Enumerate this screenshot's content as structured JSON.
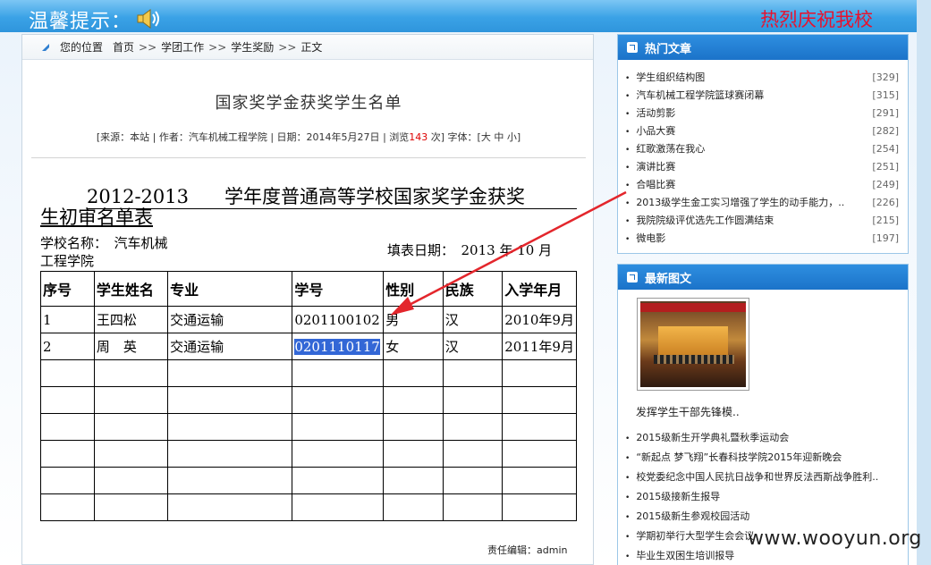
{
  "notice": {
    "label": "温馨提示：",
    "marquee": "热烈庆祝我校"
  },
  "breadcrumb": {
    "prefix": "您的位置",
    "items": [
      "首页",
      "学团工作",
      "学生奖励",
      "正文"
    ],
    "separator": ">>"
  },
  "article": {
    "title": "国家奖学金获奖学生名单",
    "meta": {
      "source": "[来源：本站",
      "author": "| 作者：汽车机械工程学院",
      "date": "| 日期：2014年5月27日",
      "views_prefix": "| 浏览",
      "views": "143",
      "views_suffix": "次] 字体：[大 中 小]"
    },
    "doc_title_year": "2012-2013",
    "doc_title_rest": "学年度普通高等学校国家奖学金获奖",
    "doc_title_line2": "生初审名单表",
    "school_label": "学校名称：　汽车机械工程学院",
    "fill_date": "填表日期：　2013 年 10 月",
    "table_headers": [
      "序号",
      "学生姓名",
      "专业",
      "学号",
      "性别",
      "民族",
      "入学年月"
    ],
    "rows": [
      [
        "1",
        "王四松",
        "交通运输",
        "0201100102",
        "男",
        "汉",
        "2010年9月"
      ],
      [
        "2",
        "周　英",
        "交通运输",
        "0201110117",
        "女",
        "汉",
        "2011年9月"
      ]
    ],
    "editor": "责任编辑：admin"
  },
  "hot_articles": {
    "title": "热门文章",
    "items": [
      {
        "text": "学生组织结构图",
        "count": "[329]"
      },
      {
        "text": "汽车机械工程学院篮球赛闭幕",
        "count": "[315]"
      },
      {
        "text": "活动剪影",
        "count": "[291]"
      },
      {
        "text": "小品大赛",
        "count": "[282]"
      },
      {
        "text": "红歌激荡在我心",
        "count": "[254]"
      },
      {
        "text": "演讲比赛",
        "count": "[251]"
      },
      {
        "text": "合唱比赛",
        "count": "[249]"
      },
      {
        "text": "2013级学生金工实习增强了学生的动手能力，..",
        "count": "[226]"
      },
      {
        "text": "我院院级评优选先工作圆满结束",
        "count": "[215]"
      },
      {
        "text": "微电影",
        "count": "[197]"
      }
    ]
  },
  "latest_pics": {
    "title": "最新图文",
    "caption": "发挥学生干部先锋模..",
    "items": [
      "2015级新生开学典礼暨秋季运动会",
      "“新起点 梦飞翔”长春科技学院2015年迎新晚会",
      "校党委纪念中国人民抗日战争和世界反法西斯战争胜利..",
      "2015级接新生报导",
      "2015级新生参观校园活动",
      "学期初举行大型学生会会议",
      "毕业生双困生培训报导"
    ]
  },
  "watermark": "www.wooyun.org",
  "colors": {
    "header": "#2f95dc",
    "marquee": "#e8112d",
    "selection": "#3367d6",
    "views": "#d00000",
    "arrow": "#e3262c"
  }
}
